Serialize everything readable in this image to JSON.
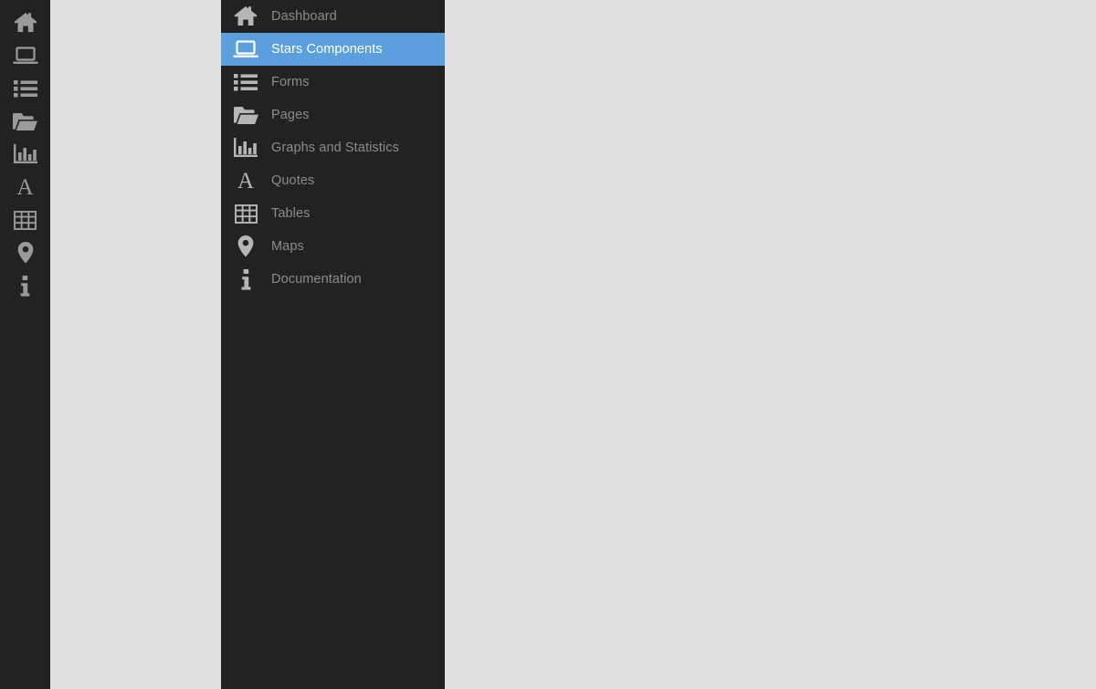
{
  "theme": {
    "rail_bg": "#222222",
    "panel_bg": "#222222",
    "content_bg": "#e0e0e0",
    "accent": "#5ba0dc",
    "icon_color": "#b6b6b6",
    "label_color": "#8c8c8c",
    "active_label_color": "#ffffff"
  },
  "icon_rail": {
    "items": [
      {
        "icon": "home-icon"
      },
      {
        "icon": "laptop-icon"
      },
      {
        "icon": "list-icon"
      },
      {
        "icon": "folder-open-icon"
      },
      {
        "icon": "bar-chart-icon"
      },
      {
        "icon": "letter-a-icon"
      },
      {
        "icon": "table-grid-icon"
      },
      {
        "icon": "map-pin-icon"
      },
      {
        "icon": "info-icon"
      }
    ]
  },
  "menu": {
    "items": [
      {
        "label": "Dashboard",
        "icon": "home-icon",
        "active": false
      },
      {
        "label": "Stars Components",
        "icon": "laptop-icon",
        "active": true
      },
      {
        "label": "Forms",
        "icon": "list-icon",
        "active": false
      },
      {
        "label": "Pages",
        "icon": "folder-open-icon",
        "active": false
      },
      {
        "label": "Graphs and Statistics",
        "icon": "bar-chart-icon",
        "active": false
      },
      {
        "label": "Quotes",
        "icon": "letter-a-icon",
        "active": false
      },
      {
        "label": "Tables",
        "icon": "table-grid-icon",
        "active": false
      },
      {
        "label": "Maps",
        "icon": "map-pin-icon",
        "active": false
      },
      {
        "label": "Documentation",
        "icon": "info-icon",
        "active": false
      }
    ]
  },
  "content": {
    "body_text": ""
  }
}
